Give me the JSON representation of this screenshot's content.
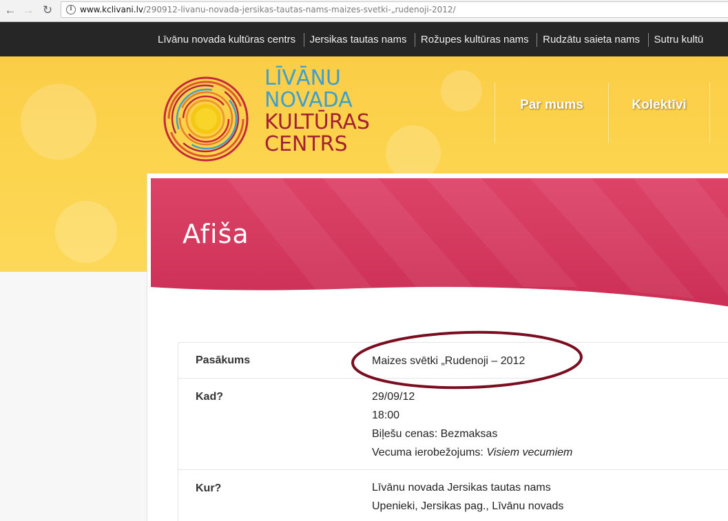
{
  "browser": {
    "url_domain": "www.kclivani.lv",
    "url_path": "/290912-livanu-novada-jersikas-tautas-nams-maizes-svetki-„rudenoji-2012/"
  },
  "topnav": {
    "items": [
      "Līvānu novada kultūras centrs",
      "Jersikas tautas nams",
      "Rožupes kultūras nams",
      "Rudzātu saieta nams",
      "Sutru kultū"
    ]
  },
  "logo": {
    "line1": "LĪVĀNU",
    "line2": "NOVADA",
    "line3": "KULTŪRAS",
    "line4": "CENTRS",
    "colors": {
      "blue": "#3d9fcf",
      "red": "#a31f34"
    }
  },
  "mainnav": {
    "items": [
      "Par mums",
      "Kolektīvi"
    ]
  },
  "banner": {
    "title": "Afiša",
    "color": "#d8385f"
  },
  "event": {
    "rows": [
      {
        "label": "Pasākums",
        "lines": [
          "Maizes svētki „Rudenoji – 2012"
        ]
      },
      {
        "label": "Kad?",
        "date": "29/09/12",
        "time": "18:00",
        "price_label": "Biļešu cenas:",
        "price": "Bezmaksas",
        "age_label": "Vecuma ierobežojums:",
        "age": "Visiem vecumiem"
      },
      {
        "label": "Kur?",
        "lines": [
          "Līvānu novada Jersikas tautas nams",
          "Upenieki, Jersikas pag., Līvānu novads"
        ]
      }
    ]
  },
  "annotation": {
    "color": "#7a0d1f"
  }
}
